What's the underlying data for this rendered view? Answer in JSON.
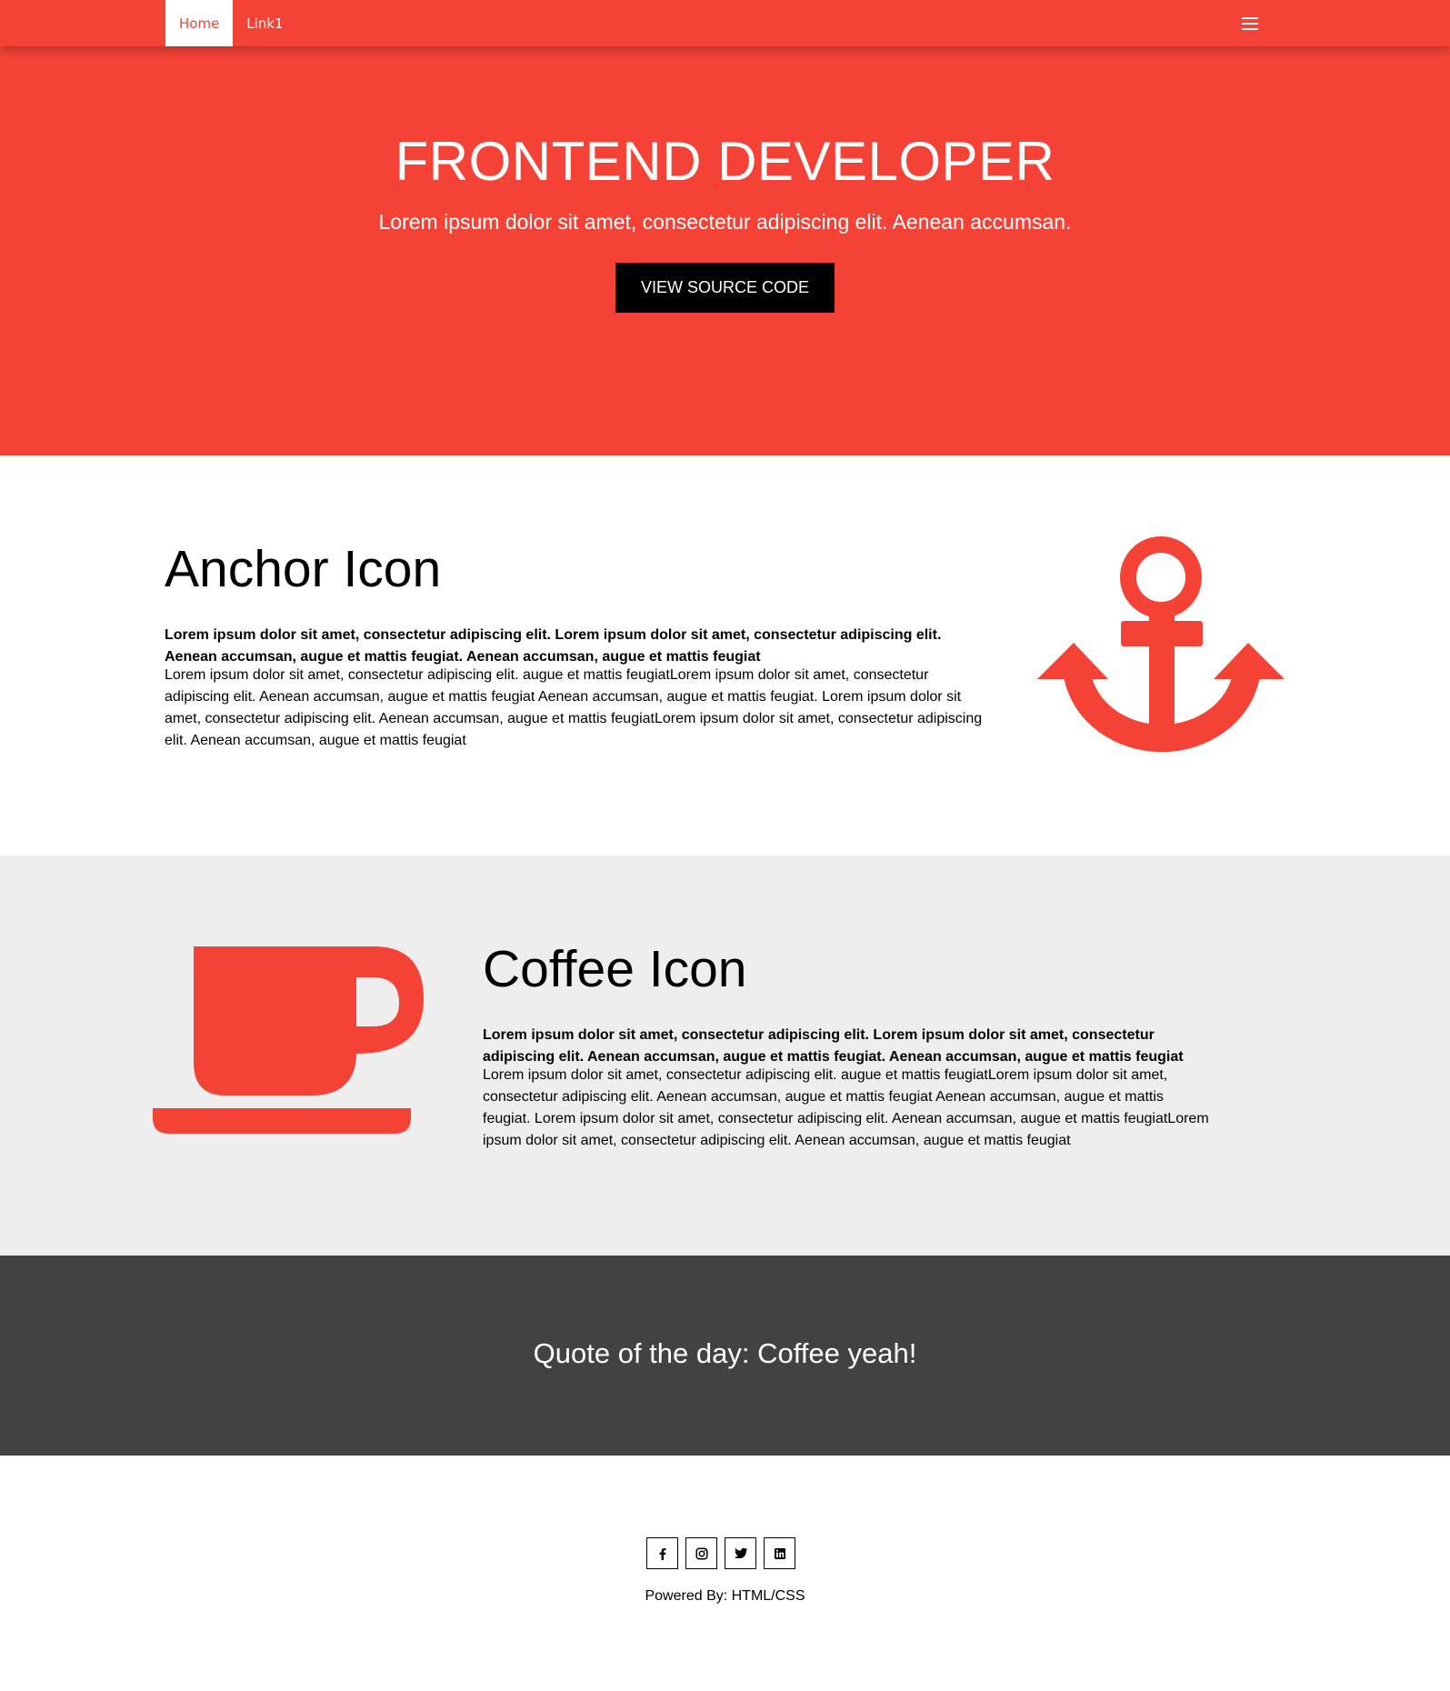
{
  "colors": {
    "accent": "#f44336",
    "dark": "#424242",
    "gray_bg": "#eeeeee"
  },
  "nav": {
    "items": [
      {
        "label": "Home",
        "active": true
      },
      {
        "label": "Link1",
        "active": false
      }
    ],
    "menu_icon": "menu-icon"
  },
  "hero": {
    "title": "FRONTEND DEVELOPER",
    "subtitle": "Lorem ipsum dolor sit amet, consectetur adipiscing elit. Aenean accumsan.",
    "button_label": "VIEW SOURCE CODE"
  },
  "anchor_section": {
    "icon": "anchor-icon",
    "title": "Anchor Icon",
    "bold_text": "Lorem ipsum dolor sit amet, consectetur adipiscing elit. Lorem ipsum dolor sit amet, consectetur adipiscing elit. Aenean accumsan, augue et mattis feugiat. Aenean accumsan, augue et mattis feugiat",
    "body_text": "Lorem ipsum dolor sit amet, consectetur adipiscing elit. augue et mattis feugiatLorem ipsum dolor sit amet, consectetur adipiscing elit. Aenean accumsan, augue et mattis feugiat Aenean accumsan, augue et mattis feugiat. Lorem ipsum dolor sit amet, consectetur adipiscing elit. Aenean accumsan, augue et mattis feugiatLorem ipsum dolor sit amet, consectetur adipiscing elit. Aenean accumsan, augue et mattis feugiat"
  },
  "coffee_section": {
    "icon": "coffee-icon",
    "title": "Coffee Icon",
    "bold_text": "Lorem ipsum dolor sit amet, consectetur adipiscing elit. Lorem ipsum dolor sit amet, consectetur adipiscing elit. Aenean accumsan, augue et mattis feugiat. Aenean accumsan, augue et mattis feugiat",
    "body_text": "Lorem ipsum dolor sit amet, consectetur adipiscing elit. augue et mattis feugiatLorem ipsum dolor sit amet, consectetur adipiscing elit. Aenean accumsan, augue et mattis feugiat Aenean accumsan, augue et mattis feugiat. Lorem ipsum dolor sit amet, consectetur adipiscing elit. Aenean accumsan, augue et mattis feugiatLorem ipsum dolor sit amet, consectetur adipiscing elit. Aenean accumsan, augue et mattis feugiat"
  },
  "quote": {
    "text": "Quote of the day: Coffee yeah!"
  },
  "footer": {
    "social_icons": [
      "facebook-icon",
      "instagram-icon",
      "twitter-icon",
      "linkedin-icon"
    ],
    "powered_prefix": "Powered By: ",
    "powered_link": "HTML/CSS"
  }
}
